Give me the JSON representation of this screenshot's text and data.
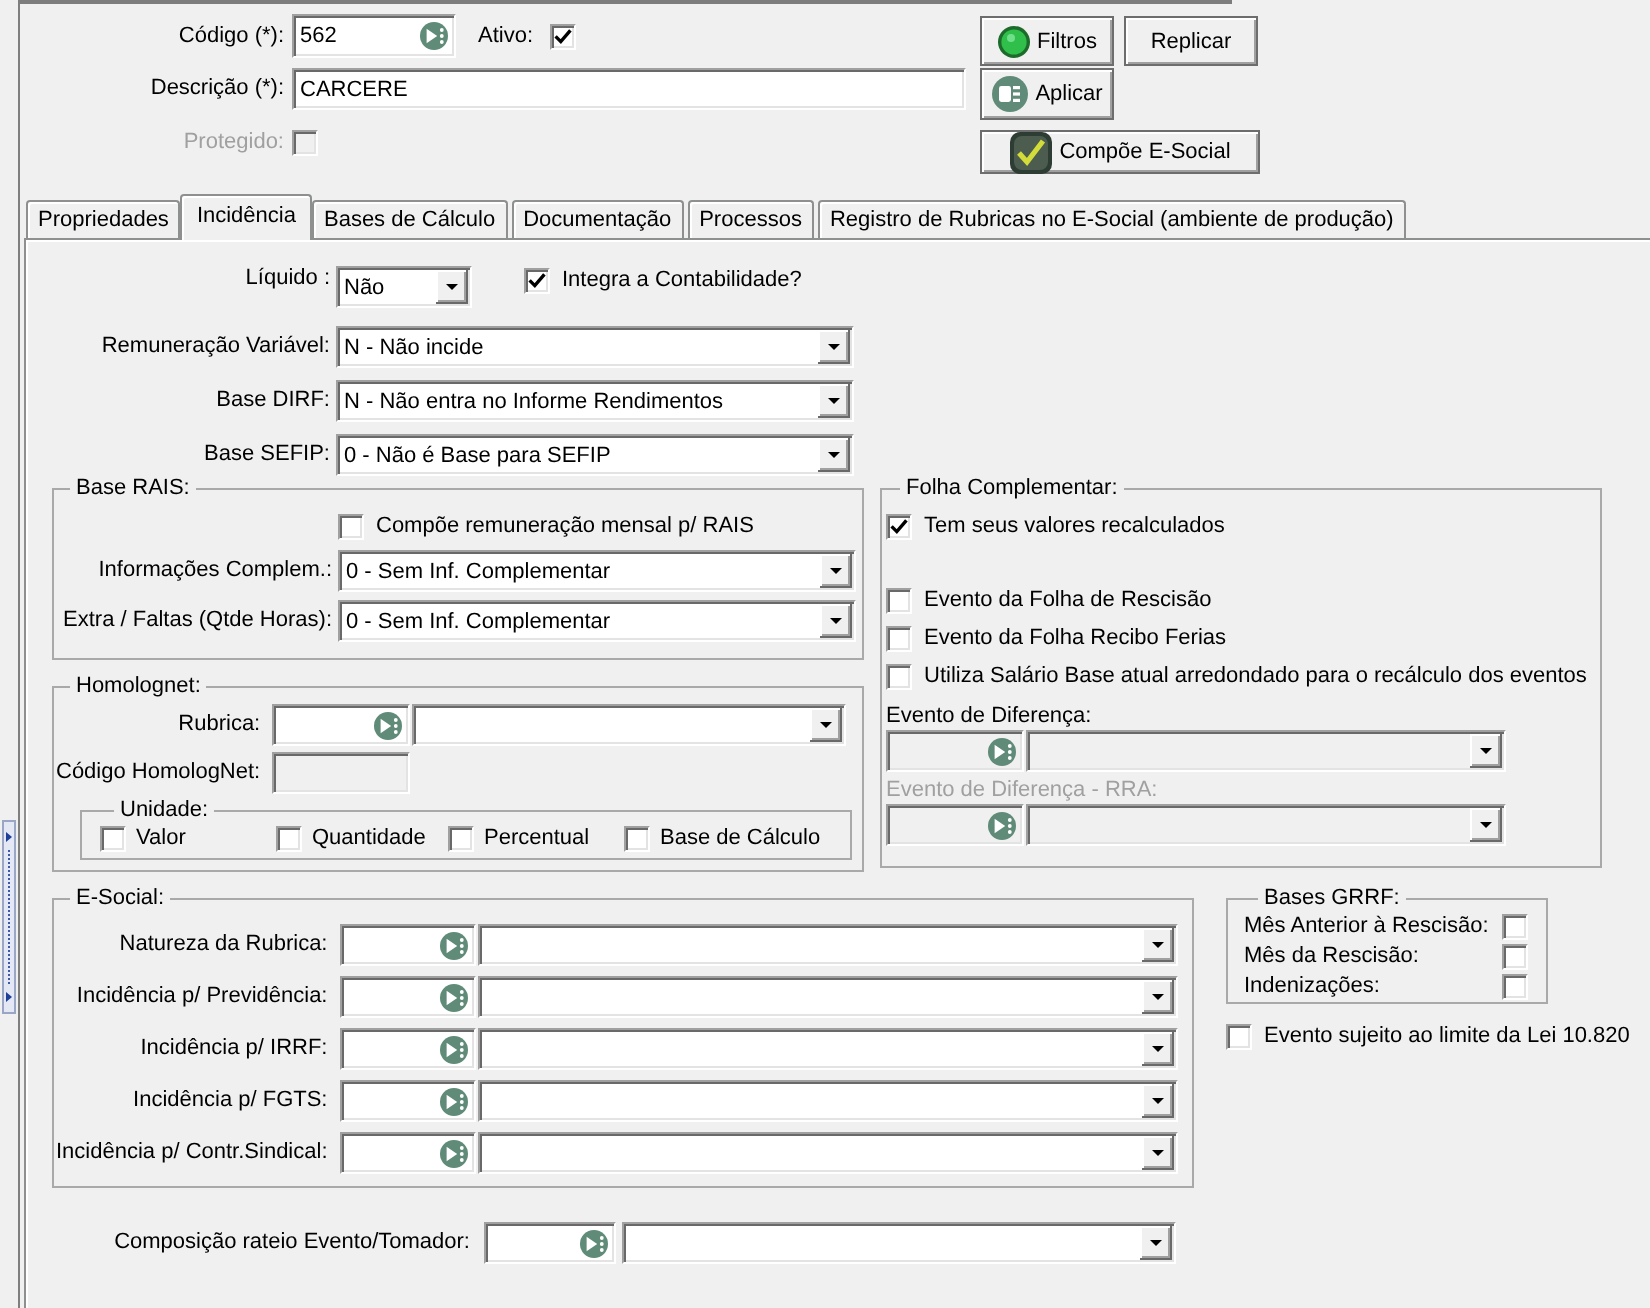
{
  "header": {
    "codigo": {
      "label": "Código (*):",
      "value": "562"
    },
    "ativo": {
      "label": "Ativo:",
      "checked": true
    },
    "descricao": {
      "label": "Descrição (*):",
      "value": "CARCERE"
    },
    "protegido": {
      "label": "Protegido:",
      "checked": false,
      "disabled": true
    },
    "buttons": [
      {
        "label": "Filtros",
        "kind": "filters"
      },
      {
        "label": "Replicar",
        "kind": "replicate"
      },
      {
        "label": "Aplicar",
        "kind": "apply"
      },
      {
        "label": "Compõe E-Social",
        "kind": "esocial"
      }
    ]
  },
  "tabs": [
    {
      "label": "Propriedades",
      "selected": false
    },
    {
      "label": "Incidência",
      "selected": true
    },
    {
      "label": "Bases de Cálculo",
      "selected": false
    },
    {
      "label": "Documentação",
      "selected": false
    },
    {
      "label": "Processos",
      "selected": false
    },
    {
      "label": "Registro de Rubricas no E-Social (ambiente de produção)",
      "selected": false
    }
  ],
  "incidencia": {
    "liquido": {
      "label": "Líquido :",
      "value": "Não"
    },
    "integra_contabilidade": {
      "label": "Integra a Contabilidade?",
      "checked": true
    },
    "selects": [
      {
        "label": "Remuneração Variável:",
        "value": "N - Não incide"
      },
      {
        "label": "Base DIRF:",
        "value": "N - Não entra no Informe Rendimentos"
      },
      {
        "label": "Base SEFIP:",
        "value": "0 - Não é Base para SEFIP"
      }
    ],
    "base_rais": {
      "title": "Base RAIS:",
      "checkbox": {
        "label": "Compõe remuneração mensal p/ RAIS",
        "checked": false
      },
      "selects": [
        {
          "label": "Informações Complem.:",
          "value": "0 - Sem Inf. Complementar"
        },
        {
          "label": "Extra / Faltas (Qtde Horas):",
          "value": "0 - Sem Inf. Complementar"
        }
      ]
    },
    "homolognet": {
      "title": "Homolognet:",
      "rubrica": {
        "label": "Rubrica:"
      },
      "codigo": {
        "label": "Código HomologNet:",
        "readonly": true
      },
      "unidade": {
        "title": "Unidade:",
        "options": [
          {
            "label": "Valor",
            "checked": false
          },
          {
            "label": "Quantidade",
            "checked": false
          },
          {
            "label": "Percentual",
            "checked": false
          },
          {
            "label": "Base de Cálculo",
            "checked": false
          }
        ]
      }
    },
    "folha_complementar": {
      "title": "Folha Complementar:",
      "checkboxes": [
        {
          "label": "Tem seus valores recalculados",
          "checked": true
        },
        {
          "label": "Evento da Folha de Rescisão",
          "checked": false
        },
        {
          "label": "Evento da Folha Recibo Ferias",
          "checked": false
        },
        {
          "label": "Utiliza Salário Base atual arredondado para o recálculo dos eventos",
          "checked": false
        }
      ],
      "lookups": [
        {
          "label": "Evento de Diferença:",
          "disabled": false,
          "readonly": true
        },
        {
          "label": "Evento de Diferença - RRA:",
          "disabled": true,
          "readonly": true
        }
      ]
    },
    "esocial": {
      "title": "E-Social:",
      "rows": [
        {
          "label": "Natureza da Rubrica:"
        },
        {
          "label": "Incidência p/ Previdência:"
        },
        {
          "label": "Incidência p/ IRRF:"
        },
        {
          "label": "Incidência p/ FGTS:"
        },
        {
          "label": "Incidência p/ Contr.Sindical:"
        }
      ]
    },
    "bases_grrf": {
      "title": "Bases GRRF:",
      "rows": [
        {
          "label": "Mês Anterior à Rescisão:",
          "checked": false
        },
        {
          "label": "Mês da Rescisão:",
          "checked": false
        },
        {
          "label": "Indenizações:",
          "checked": false
        }
      ]
    },
    "lei_10820": {
      "label": "Evento sujeito ao limite da Lei 10.820",
      "checked": false
    },
    "rateio": {
      "label": "Composição rateio Evento/Tomador:"
    }
  }
}
